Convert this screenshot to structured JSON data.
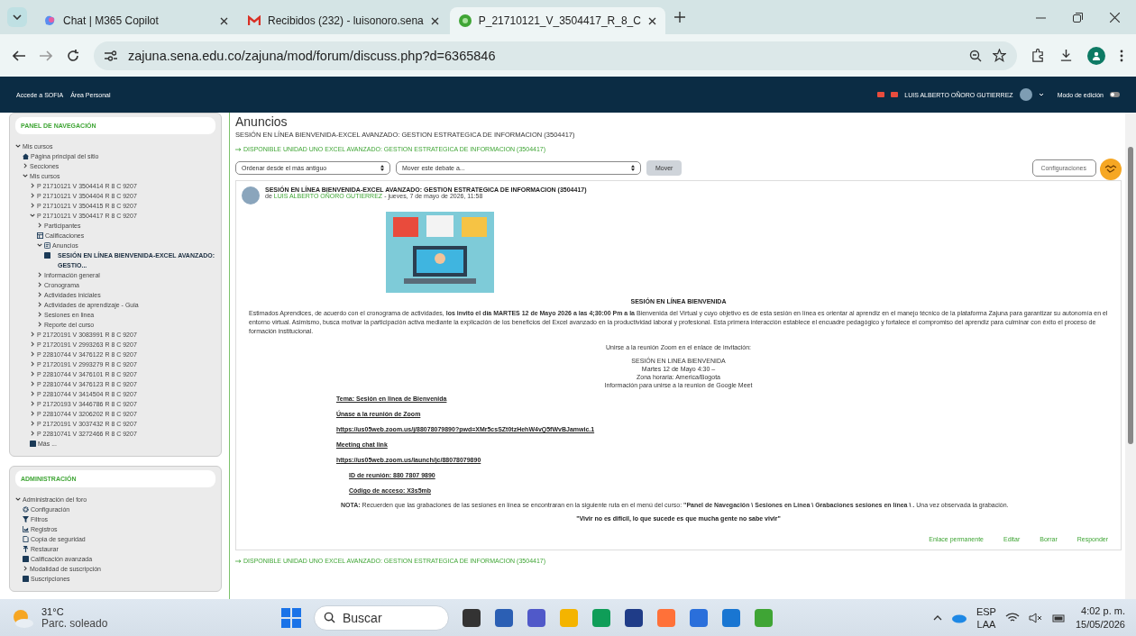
{
  "browser": {
    "tabs": [
      {
        "title": "Chat | M365 Copilot",
        "selected": false
      },
      {
        "title": "Recibidos (232) - luisonoro.sena",
        "selected": false
      },
      {
        "title": "P_21710121_V_3504417_R_8_C",
        "selected": true
      }
    ],
    "url": "zajuna.sena.edu.co/zajuna/mod/forum/discuss.php?d=6365846"
  },
  "site_nav": {
    "links": [
      "Accede a SOFIA",
      "Área Personal"
    ],
    "user_name": "LUIS ALBERTO OÑORO GUTIERREZ",
    "edit_mode": {
      "label": "Modo de edición",
      "on": false
    }
  },
  "nav_panel": {
    "title": "PANEL DE NAVEGACIÓN",
    "tree": [
      {
        "label": "Mis cursos",
        "kind": "folder",
        "expanded": true,
        "children": [
          {
            "label": "Página principal del sitio",
            "kind": "home"
          },
          {
            "label": "Secciones",
            "kind": "folder",
            "expanded": false
          },
          {
            "label": "Mis cursos",
            "kind": "folder",
            "expanded": true,
            "children": [
              {
                "label": "P 21710121 V 3504414 R 8 C 9207",
                "kind": "folder",
                "expanded": false
              },
              {
                "label": "P 21710121 V 3504404 R 8 C 9207",
                "kind": "folder",
                "expanded": false
              },
              {
                "label": "P 21710121 V 3504415 R 8 C 9207",
                "kind": "folder",
                "expanded": false
              },
              {
                "label": "P 21710121 V 3504417 R 8 C 9207",
                "kind": "folder",
                "expanded": true,
                "children": [
                  {
                    "label": "Participantes",
                    "kind": "folder",
                    "expanded": false
                  },
                  {
                    "label": "Calificaciones",
                    "kind": "grades"
                  },
                  {
                    "label": "Anuncios",
                    "kind": "forum",
                    "expanded": true,
                    "children": [
                      {
                        "label": "SESIÓN EN LÍNEA BIENVENIDA-EXCEL AVANZADO: GESTIO...",
                        "kind": "current"
                      }
                    ]
                  },
                  {
                    "label": "Información general",
                    "kind": "folder",
                    "expanded": false
                  },
                  {
                    "label": "Cronograma",
                    "kind": "folder",
                    "expanded": false
                  },
                  {
                    "label": "Actividades iniciales",
                    "kind": "folder",
                    "expanded": false
                  },
                  {
                    "label": "Actividades de aprendizaje - Guia",
                    "kind": "folder",
                    "expanded": false
                  },
                  {
                    "label": "Sesiones en linea",
                    "kind": "folder",
                    "expanded": false
                  },
                  {
                    "label": "Reporte del curso",
                    "kind": "folder",
                    "expanded": false
                  }
                ]
              },
              {
                "label": "P 21720191 V 3083991 R 8 C 9207",
                "kind": "folder",
                "expanded": false
              },
              {
                "label": "P 21720191 V 2993263 R 8 C 9207",
                "kind": "folder",
                "expanded": false
              },
              {
                "label": "P 22810744 V 3476122 R 8 C 9207",
                "kind": "folder",
                "expanded": false
              },
              {
                "label": "P 21720191 V 2993279 R 8 C 9207",
                "kind": "folder",
                "expanded": false
              },
              {
                "label": "P 22810744 V 3476101 R 8 C 9207",
                "kind": "folder",
                "expanded": false
              },
              {
                "label": "P 22810744 V 3476123 R 8 C 9207",
                "kind": "folder",
                "expanded": false
              },
              {
                "label": "P 22810744 V 3414504 R 8 C 9207",
                "kind": "folder",
                "expanded": false
              },
              {
                "label": "P 21720193 V 3446786 R 8 C 9207",
                "kind": "folder",
                "expanded": false
              },
              {
                "label": "P 22810744 V 3206202 R 8 C 9207",
                "kind": "folder",
                "expanded": false
              },
              {
                "label": "P 21720191 V 3037432 R 8 C 9207",
                "kind": "folder",
                "expanded": false
              },
              {
                "label": "P 22810741 V 3272466 R 8 C 9207",
                "kind": "folder",
                "expanded": false
              },
              {
                "label": "Más ...",
                "kind": "square"
              }
            ]
          }
        ]
      }
    ]
  },
  "admin_panel": {
    "title": "ADMINISTRACIÓN",
    "tree": [
      {
        "label": "Administración del foro",
        "kind": "folder",
        "expanded": true,
        "children": [
          {
            "label": "Configuración",
            "kind": "gear"
          },
          {
            "label": "Filtros",
            "kind": "filter"
          },
          {
            "label": "Registros",
            "kind": "logs"
          },
          {
            "label": "Copia de seguridad",
            "kind": "file"
          },
          {
            "label": "Restaurar",
            "kind": "restore"
          },
          {
            "label": "Calificación avanzada",
            "kind": "square"
          },
          {
            "label": "Modalidad de suscripción",
            "kind": "folder",
            "expanded": false
          },
          {
            "label": "Suscripciones",
            "kind": "square"
          }
        ]
      }
    ]
  },
  "main": {
    "heading": "Anuncios",
    "subtitle": "SESIÓN EN LÍNEA BIENVENIDA-EXCEL AVANZADO: GESTION ESTRATEGICA DE INFORMACION (3504417)",
    "section_link": "DISPONIBLE UNIDAD UNO  EXCEL AVANZADO: GESTION ESTRATEGICA DE INFORMACION (3504417)",
    "sort_select": "Ordenar desde el más antiguo",
    "move_select": "Mover este debate a...",
    "move_button": "Mover",
    "settings_button": "Configuraciones",
    "post": {
      "title": "SESIÓN EN LÍNEA BIENVENIDA-EXCEL AVANZADO: GESTION ESTRATEGICA DE INFORMACION (3504417)",
      "by": "de",
      "author": "LUIS ALBERTO OÑORO GUTIERREZ",
      "date": "- jueves, 7 de mayo de 2026, 11:58",
      "heading": "SESIÓN EN LÍNEA BIENVENIDA",
      "paragraph": "Estimados Aprendices, de acuerdo con el cronograma de actividades, **los invito el día MARTES  12 de  Mayo  2026  a las 4;30:00  Pm  a la** Bienvenida del Virtual  y cuyo objetivo es de esta sesión en línea es orientar al aprendiz en el manejo técnico de la plataforma Zajuna para garantizar su autonomía en el entorno virtual. Asimismo, busca motivar la participación activa mediante la explicación de los beneficios del Excel avanzado en la productividad laboral y profesional. Esta primera interacción establece el encuadre pedagógico y fortalece el compromiso del aprendiz para culminar con éxito el proceso de formación institucional.",
      "invite": "Unirse a la reunión Zoom en el enlace de invitación:",
      "details": [
        "SESIÓN EN LINEA BIENVENIDA",
        "Martes 12 de Mayo  4:30  –",
        "Zona horaria: America/Bogota",
        "Información para unirse a la reunion de Google Meet"
      ],
      "links": [
        {
          "text": "Tema: Sesión en linea de Bienvenida",
          "kind": "link"
        },
        {
          "text": "Únase a la reunión de Zoom",
          "kind": "link"
        },
        {
          "text": "https://us05web.zoom.us/j/88078079890?pwd=XMr5csSZt0tzHehW4vQ5fWvBJamwic.1",
          "kind": "link"
        },
        {
          "text": "Meeting chat link",
          "kind": "link"
        },
        {
          "text": "https://us05web.zoom.us/launch/jc/88078079890",
          "kind": "link"
        },
        {
          "text": "ID de reunión: 880 7807 9890",
          "kind": "indented"
        },
        {
          "text": "Código de acceso: X3s5mb",
          "kind": "indented"
        }
      ],
      "note": "**NOTA:** Recuerden que las grabaciones de las sesiones en línea se encontraran en la siguiente ruta en el menú del curso: **\"Panel de Navegación \\ Sesiones en Línea \\ Grabaciones sesiones en línea \\ .** Una vez observada la grabación.",
      "quote": "\"Vivir no es difícil, lo que sucede es que mucha gente no sabe vivir\"",
      "actions": [
        "Enlace permanente",
        "Editar",
        "Borrar",
        "Responder"
      ]
    },
    "footer_link": "DISPONIBLE UNIDAD UNO  EXCEL AVANZADO: GESTION ESTRATEGICA DE INFORMACION (3504417)"
  },
  "taskbar": {
    "temperature": "31°C",
    "weather": "Parc. soleado",
    "search": "Buscar",
    "language": "ESP",
    "layout": "LAA",
    "time": "4:02 p. m.",
    "date": "15/05/2026"
  }
}
